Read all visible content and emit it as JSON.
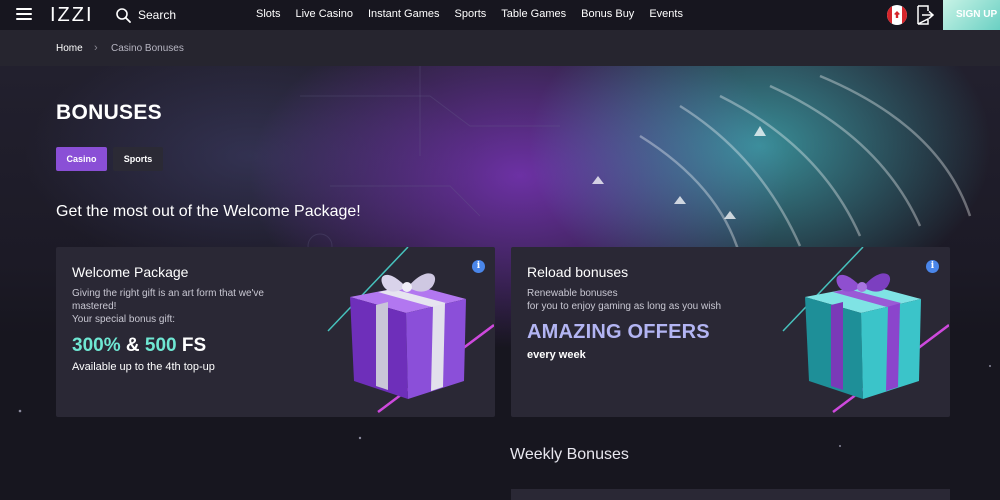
{
  "header": {
    "logo": "IZZI",
    "search_label": "Search",
    "nav": [
      "Slots",
      "Live Casino",
      "Instant Games",
      "Sports",
      "Table Games",
      "Bonus Buy",
      "Events"
    ],
    "signup_label": "SIGN UP",
    "flag": "canada-flag",
    "login_icon": "login-icon"
  },
  "breadcrumb": {
    "home": "Home",
    "current": "Casino Bonuses"
  },
  "page": {
    "title": "BONUSES",
    "tabs": [
      {
        "label": "Casino",
        "active": true
      },
      {
        "label": "Sports",
        "active": false
      }
    ],
    "subtitle": "Get the most out of the Welcome Package!"
  },
  "cards": [
    {
      "title": "Welcome Package",
      "line1": "Giving the right gift is an art form that we've mastered!",
      "line2": "Your special bonus gift:",
      "pct": "300%",
      "amp": " & ",
      "fs_num": "500",
      "fs_unit": " FS",
      "note": "Available up to the 4th top-up",
      "gift_color": "#8b4fd9"
    },
    {
      "title": "Reload bonuses",
      "line1": "Renewable bonuses",
      "line2": "for you to enjoy gaming as long as you wish",
      "headline": "AMAZING OFFERS",
      "sub": "every week",
      "gift_color": "#3bc4c9"
    }
  ],
  "weekly": {
    "title": "Weekly Bonuses"
  },
  "colors": {
    "accent": "#8a4fd6",
    "teal": "#6fe7d3",
    "offers": "#b3b5f3",
    "info": "#4a86ea"
  }
}
